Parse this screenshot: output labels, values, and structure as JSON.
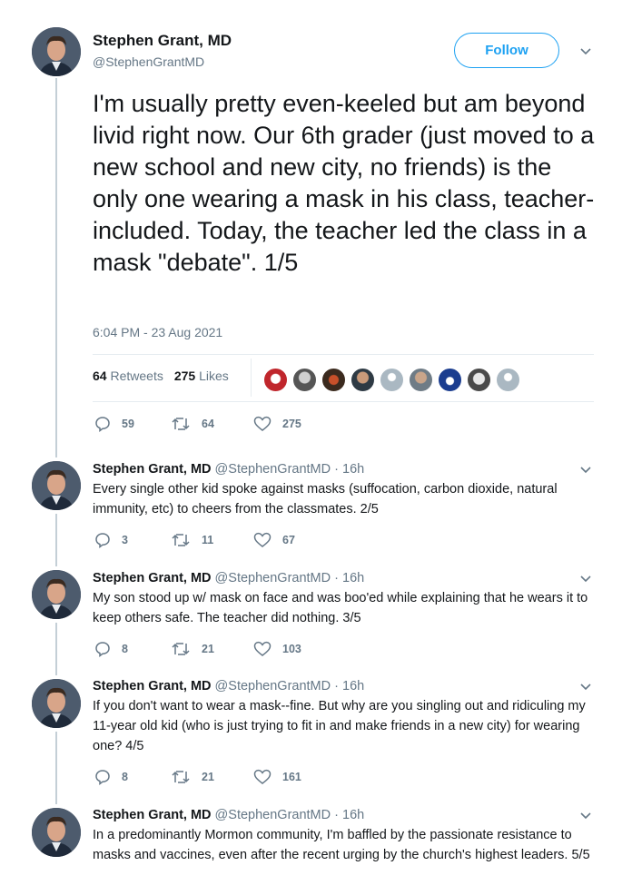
{
  "author": {
    "name": "Stephen Grant, MD",
    "handle": "@StephenGrantMD"
  },
  "main_tweet": {
    "follow_label": "Follow",
    "text": "I'm usually pretty even-keeled but am beyond livid right now. Our 6th grader (just moved to a new school and new city, no friends) is the only one wearing a mask in his class, teacher-included. Today, the teacher led the class in a mask \"debate\". 1/5",
    "timestamp": "6:04 PM - 23 Aug 2021",
    "retweets_count": "64",
    "retweets_label": "Retweets",
    "likes_count": "275",
    "likes_label": "Likes",
    "actions": {
      "replies": "59",
      "retweets": "64",
      "likes": "275"
    }
  },
  "replies": [
    {
      "name": "Stephen Grant, MD",
      "handle": "@StephenGrantMD",
      "time": "16h",
      "text": "Every single other kid spoke against masks (suffocation, carbon dioxide, natural immunity, etc) to cheers from the classmates. 2/5",
      "replies": "3",
      "retweets": "11",
      "likes": "67"
    },
    {
      "name": "Stephen Grant, MD",
      "handle": "@StephenGrantMD",
      "time": "16h",
      "text": "My son stood up w/ mask on face and was boo'ed while explaining that he wears it to keep others safe. The teacher did nothing. 3/5",
      "replies": "8",
      "retweets": "21",
      "likes": "103"
    },
    {
      "name": "Stephen Grant, MD",
      "handle": "@StephenGrantMD",
      "time": "16h",
      "text": "If you don't want to wear a mask--fine. But why are you singling out and ridiculing my 11-year old kid (who is just trying to fit in and make friends in a new city) for wearing one? 4/5",
      "replies": "8",
      "retweets": "21",
      "likes": "161"
    },
    {
      "name": "Stephen Grant, MD",
      "handle": "@StephenGrantMD",
      "time": "16h",
      "text": "In a predominantly Mormon community, I'm baffled by the passionate resistance to masks and vaccines, even after the recent urging by the church's highest leaders.  5/5"
    }
  ],
  "separator": "·",
  "colors": {
    "accent": "#1da1f2",
    "secondary_text": "#657786",
    "thread_line": "#c4cfd6"
  }
}
